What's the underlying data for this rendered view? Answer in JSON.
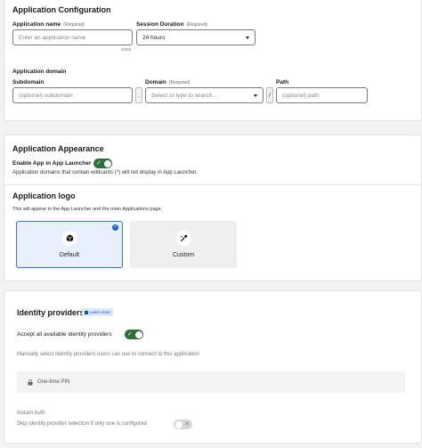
{
  "app_config": {
    "title": "Application Configuration",
    "app_name_label": "Application name",
    "app_name_required": "(Required)",
    "app_name_placeholder": "Enter an application name",
    "app_name_counter": "0/350",
    "session_label": "Session Duration",
    "session_required": "(Required)",
    "session_value": "24 hours",
    "domain_section_label": "Application domain",
    "subdomain_label": "Subdomain",
    "subdomain_placeholder": "(optional) subdomain",
    "dot_separator": ".",
    "domain_label": "Domain",
    "domain_required": "(Required)",
    "domain_placeholder": "Select or type to search...",
    "slash_separator": "/",
    "path_label": "Path",
    "path_placeholder": "(optional) path"
  },
  "appearance": {
    "title": "Application Appearance",
    "launcher_label": "Enable App in App Launcher",
    "launcher_enabled": true,
    "wildcard_note": "Application domains that contain wildcards (*) will not display in App Launcher.",
    "logo_title": "Application logo",
    "logo_note": "This will appear in the App Launcher and the main Applications page.",
    "logo_options": [
      {
        "label": "Default",
        "selected": true,
        "icon": "cube-icon"
      },
      {
        "label": "Custom",
        "selected": false,
        "icon": "eyedropper-icon"
      }
    ]
  },
  "identity": {
    "title": "Identity providers",
    "learn_more": "Learn more",
    "accept_all_label": "Accept all available identity providers",
    "accept_all_enabled": true,
    "manual_note": "Manually select identity providers users can use to connect to this application",
    "providers": [
      {
        "label": "One-time PIN",
        "icon": "pin-icon"
      }
    ],
    "instant_auth_label": "Instant Auth",
    "instant_auth_note": "Skip identity provider selection if only one is configured",
    "instant_auth_enabled": false
  }
}
